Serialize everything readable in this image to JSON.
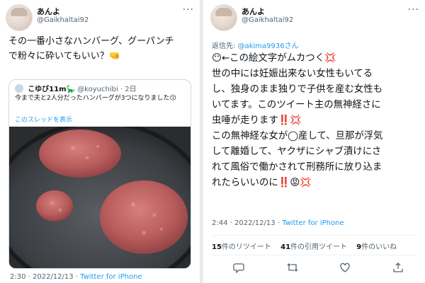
{
  "left_tweet": {
    "display_name": "あんよ",
    "handle": "@Gaikhaltai92",
    "more_icon": "more-dots-icon",
    "text_line1": "その一番小さなハンバーグ、グーパンチ",
    "text_line2": "で粉々に砕いてもいい？🤜",
    "quote": {
      "display_name": "こゆび11m🦕",
      "handle": "@koyuchibi",
      "time": "2日",
      "text": "今まで夫と2人分だったハンバーグが3つになりました😗",
      "show_thread": "このスレッドを表示",
      "photo_desc": "frying-pan-with-three-hamburger-patties"
    },
    "timestamp": "2:30 · 2022/12/13 · ",
    "source": "Twitter for iPhone"
  },
  "right_tweet": {
    "display_name": "あんよ",
    "handle": "@Gaikhaltai92",
    "more_icon": "more-dots-icon",
    "reply_prefix": "返信先: ",
    "reply_to": "@akima9936さん",
    "lines": [
      "😶←この絵文字がムカつく💢",
      "世の中には妊娠出来ない女性もいてる",
      "し、独身のまま独りで子供を産む女性も",
      "いてます。このツイート主の無神経さに",
      "虫唾が走ります‼️💢",
      "この無神経な女が◯産して、旦那が浮気",
      "して離婚して、ヤクザにシャブ漬けにさ",
      "れて風俗で働かされて刑務所に放り込ま",
      "れたらいいのに‼️😡💢"
    ],
    "timestamp": "2:44 · 2022/12/13 · ",
    "source": "Twitter for iPhone",
    "retweets_count": "15",
    "retweets_label": "件のリツイート",
    "quotes_count": "41",
    "quotes_label": "件の引用ツイート",
    "likes_count": "9",
    "likes_label": "件のいいね",
    "actions": [
      "reply-icon",
      "retweet-icon",
      "like-icon",
      "share-icon"
    ]
  }
}
